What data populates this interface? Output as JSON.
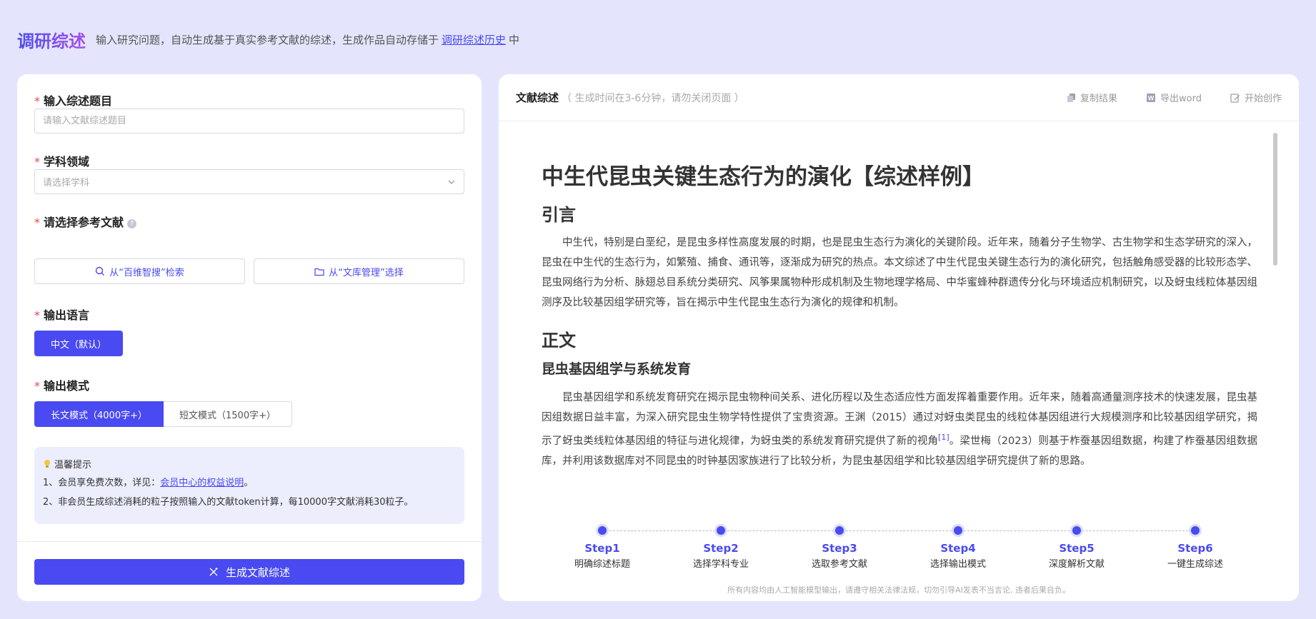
{
  "header": {
    "brand": "调研综述",
    "description": "输入研究问题，自动生成基于真实参考文献的综述，生成作品自动存储于",
    "history_link": "调研综述历史",
    "suffix": "中"
  },
  "form": {
    "topic": {
      "label": "输入综述题目",
      "placeholder": "请输入文献综述题目",
      "value": ""
    },
    "discipline": {
      "label": "学科领域",
      "placeholder": "请选择学科"
    },
    "references": {
      "label": "请选择参考文献",
      "search_button": "从“百维智搜”检索",
      "library_button": "从“文库管理”选择"
    },
    "language": {
      "label": "输出语言",
      "selected": "中文（默认）"
    },
    "mode": {
      "label": "输出模式",
      "long": "长文模式（4000字+）",
      "short": "短文模式（1500字+）"
    },
    "tips": {
      "title": "温馨提示",
      "line1_prefix": "1、会员享免费次数，详见：",
      "line1_link": "会员中心的权益说明",
      "line1_suffix": "。",
      "line2": "2、非会员生成综述消耗的粒子按照输入的文献token计算，每10000字文献消耗30粒子。"
    },
    "generate_button": "生成文献综述"
  },
  "result": {
    "title": "文献综述",
    "subtitle": "（ 生成时间在3-6分钟，请勿关闭页面 ）",
    "actions": {
      "copy": "复制结果",
      "export": "导出word",
      "create": "开始创作"
    },
    "article": {
      "title": "中生代昆虫关键生态行为的演化【综述样例】",
      "intro_heading": "引言",
      "intro_text": "中生代，特别是白垩纪，是昆虫多样性高度发展的时期，也是昆虫生态行为演化的关键阶段。近年来，随着分子生物学、古生物学和生态学研究的深入，昆虫在中生代的生态行为，如繁殖、捕食、通讯等，逐渐成为研究的热点。本文综述了中生代昆虫关键生态行为的演化研究，包括触角感受器的比较形态学、昆虫网络行为分析、脉翅总目系统分类研究、风筝果属物种形成机制及生物地理学格局、中华蜜蜂种群遗传分化与环境适应机制研究，以及蚜虫线粒体基因组测序及比较基因组学研究等，旨在揭示中生代昆虫生态行为演化的规律和机制。",
      "body_heading": "正文",
      "section1_heading": "昆虫基因组学与系统发育",
      "section1_text_a": "昆虫基因组学和系统发育研究在揭示昆虫物种间关系、进化历程以及生态适应性方面发挥着重要作用。近年来，随着高通量测序技术的快速发展，昆虫基因组数据日益丰富，为深入研究昆虫生物学特性提供了宝贵资源。王渊（2015）通过对蚜虫类昆虫的线粒体基因组进行大规模测序和比较基因组学研究，揭示了蚜虫类线粒体基因组的特征与进化规律，为蚜虫类的系统发育研究提供了新的视角",
      "section1_ref": "[1]",
      "section1_text_b": "。梁世梅（2023）则基于柞蚕基因组数据，构建了柞蚕基因组数据库，并利用该数据库对不同昆虫的时钟基因家族进行了比较分析，为昆虫基因组学和比较基因组学研究提供了新的思路。"
    },
    "steps": [
      {
        "name": "Step1",
        "desc": "明确综述标题"
      },
      {
        "name": "Step2",
        "desc": "选择学科专业"
      },
      {
        "name": "Step3",
        "desc": "选取参考文献"
      },
      {
        "name": "Step4",
        "desc": "选择输出模式"
      },
      {
        "name": "Step5",
        "desc": "深度解析文献"
      },
      {
        "name": "Step6",
        "desc": "一键生成综述"
      }
    ],
    "footer_note": "所有内容均由人工智能模型输出，请遵守相关法律法规，切勿引导AI发表不当言论, 违者后果自负。"
  },
  "colors": {
    "accent": "#4a4af2",
    "background": "#e4e5fd",
    "required": "#e5484d"
  },
  "icons": [
    "search-icon",
    "folder-icon",
    "chevron-down-icon",
    "question-icon",
    "bulb-icon",
    "magic-wand-icon",
    "copy-icon",
    "word-icon",
    "edit-icon"
  ]
}
